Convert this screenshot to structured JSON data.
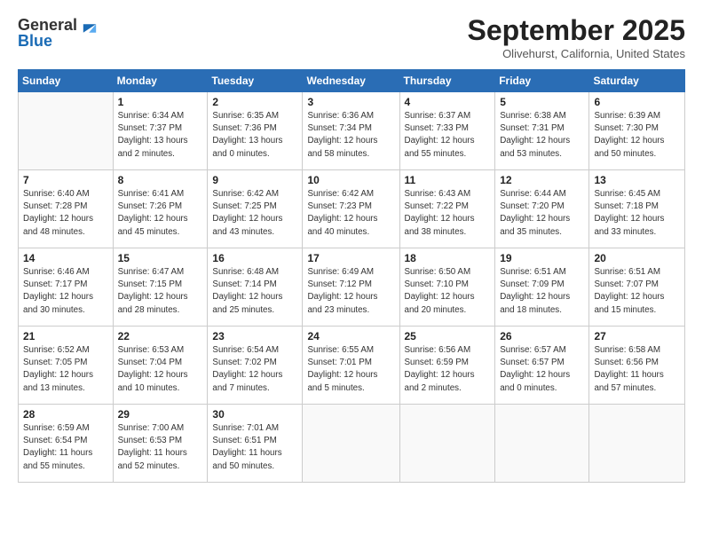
{
  "logo": {
    "line1": "General",
    "line2": "Blue"
  },
  "title": "September 2025",
  "location": "Olivehurst, California, United States",
  "days_of_week": [
    "Sunday",
    "Monday",
    "Tuesday",
    "Wednesday",
    "Thursday",
    "Friday",
    "Saturday"
  ],
  "weeks": [
    [
      {
        "num": "",
        "info": ""
      },
      {
        "num": "1",
        "info": "Sunrise: 6:34 AM\nSunset: 7:37 PM\nDaylight: 13 hours\nand 2 minutes."
      },
      {
        "num": "2",
        "info": "Sunrise: 6:35 AM\nSunset: 7:36 PM\nDaylight: 13 hours\nand 0 minutes."
      },
      {
        "num": "3",
        "info": "Sunrise: 6:36 AM\nSunset: 7:34 PM\nDaylight: 12 hours\nand 58 minutes."
      },
      {
        "num": "4",
        "info": "Sunrise: 6:37 AM\nSunset: 7:33 PM\nDaylight: 12 hours\nand 55 minutes."
      },
      {
        "num": "5",
        "info": "Sunrise: 6:38 AM\nSunset: 7:31 PM\nDaylight: 12 hours\nand 53 minutes."
      },
      {
        "num": "6",
        "info": "Sunrise: 6:39 AM\nSunset: 7:30 PM\nDaylight: 12 hours\nand 50 minutes."
      }
    ],
    [
      {
        "num": "7",
        "info": "Sunrise: 6:40 AM\nSunset: 7:28 PM\nDaylight: 12 hours\nand 48 minutes."
      },
      {
        "num": "8",
        "info": "Sunrise: 6:41 AM\nSunset: 7:26 PM\nDaylight: 12 hours\nand 45 minutes."
      },
      {
        "num": "9",
        "info": "Sunrise: 6:42 AM\nSunset: 7:25 PM\nDaylight: 12 hours\nand 43 minutes."
      },
      {
        "num": "10",
        "info": "Sunrise: 6:42 AM\nSunset: 7:23 PM\nDaylight: 12 hours\nand 40 minutes."
      },
      {
        "num": "11",
        "info": "Sunrise: 6:43 AM\nSunset: 7:22 PM\nDaylight: 12 hours\nand 38 minutes."
      },
      {
        "num": "12",
        "info": "Sunrise: 6:44 AM\nSunset: 7:20 PM\nDaylight: 12 hours\nand 35 minutes."
      },
      {
        "num": "13",
        "info": "Sunrise: 6:45 AM\nSunset: 7:18 PM\nDaylight: 12 hours\nand 33 minutes."
      }
    ],
    [
      {
        "num": "14",
        "info": "Sunrise: 6:46 AM\nSunset: 7:17 PM\nDaylight: 12 hours\nand 30 minutes."
      },
      {
        "num": "15",
        "info": "Sunrise: 6:47 AM\nSunset: 7:15 PM\nDaylight: 12 hours\nand 28 minutes."
      },
      {
        "num": "16",
        "info": "Sunrise: 6:48 AM\nSunset: 7:14 PM\nDaylight: 12 hours\nand 25 minutes."
      },
      {
        "num": "17",
        "info": "Sunrise: 6:49 AM\nSunset: 7:12 PM\nDaylight: 12 hours\nand 23 minutes."
      },
      {
        "num": "18",
        "info": "Sunrise: 6:50 AM\nSunset: 7:10 PM\nDaylight: 12 hours\nand 20 minutes."
      },
      {
        "num": "19",
        "info": "Sunrise: 6:51 AM\nSunset: 7:09 PM\nDaylight: 12 hours\nand 18 minutes."
      },
      {
        "num": "20",
        "info": "Sunrise: 6:51 AM\nSunset: 7:07 PM\nDaylight: 12 hours\nand 15 minutes."
      }
    ],
    [
      {
        "num": "21",
        "info": "Sunrise: 6:52 AM\nSunset: 7:05 PM\nDaylight: 12 hours\nand 13 minutes."
      },
      {
        "num": "22",
        "info": "Sunrise: 6:53 AM\nSunset: 7:04 PM\nDaylight: 12 hours\nand 10 minutes."
      },
      {
        "num": "23",
        "info": "Sunrise: 6:54 AM\nSunset: 7:02 PM\nDaylight: 12 hours\nand 7 minutes."
      },
      {
        "num": "24",
        "info": "Sunrise: 6:55 AM\nSunset: 7:01 PM\nDaylight: 12 hours\nand 5 minutes."
      },
      {
        "num": "25",
        "info": "Sunrise: 6:56 AM\nSunset: 6:59 PM\nDaylight: 12 hours\nand 2 minutes."
      },
      {
        "num": "26",
        "info": "Sunrise: 6:57 AM\nSunset: 6:57 PM\nDaylight: 12 hours\nand 0 minutes."
      },
      {
        "num": "27",
        "info": "Sunrise: 6:58 AM\nSunset: 6:56 PM\nDaylight: 11 hours\nand 57 minutes."
      }
    ],
    [
      {
        "num": "28",
        "info": "Sunrise: 6:59 AM\nSunset: 6:54 PM\nDaylight: 11 hours\nand 55 minutes."
      },
      {
        "num": "29",
        "info": "Sunrise: 7:00 AM\nSunset: 6:53 PM\nDaylight: 11 hours\nand 52 minutes."
      },
      {
        "num": "30",
        "info": "Sunrise: 7:01 AM\nSunset: 6:51 PM\nDaylight: 11 hours\nand 50 minutes."
      },
      {
        "num": "",
        "info": ""
      },
      {
        "num": "",
        "info": ""
      },
      {
        "num": "",
        "info": ""
      },
      {
        "num": "",
        "info": ""
      }
    ]
  ]
}
